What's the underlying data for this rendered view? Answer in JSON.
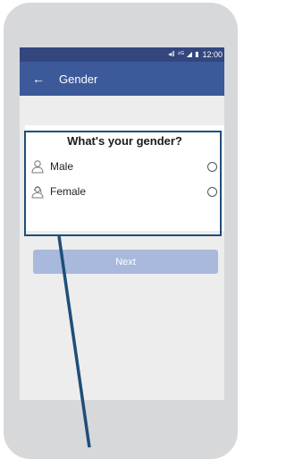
{
  "status_bar": {
    "time": "12:00",
    "icons": [
      "mute-icon",
      "network-icon",
      "signal-icon",
      "battery-icon"
    ]
  },
  "app_bar": {
    "title": "Gender",
    "back_icon": "arrow-left-icon"
  },
  "gender_card": {
    "title": "What's your gender?",
    "options": [
      {
        "label": "Male",
        "icon": "male-person-icon",
        "selected": false
      },
      {
        "label": "Female",
        "icon": "female-person-icon",
        "selected": false
      }
    ]
  },
  "next_button": {
    "label": "Next"
  },
  "colors": {
    "status_bar": "#33467e",
    "app_bar": "#3c5a9a",
    "next_button": "#a9b9dc",
    "highlight": "#1f4e79",
    "phone_frame": "#d7d8da",
    "screen_bg": "#ededed"
  }
}
